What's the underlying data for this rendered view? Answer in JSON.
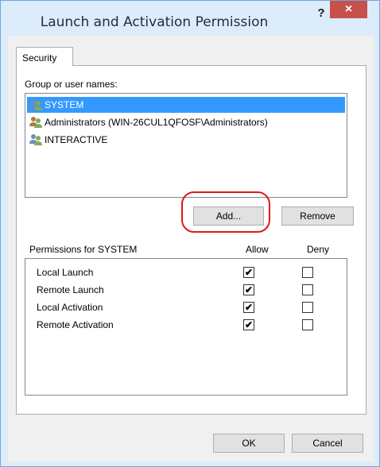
{
  "window": {
    "title": "Launch and Activation Permission",
    "help_label": "?",
    "close_label": "×"
  },
  "tab": {
    "label": "Security"
  },
  "users": {
    "label": "Group or user names:",
    "items": [
      {
        "name": "SYSTEM",
        "selected": true
      },
      {
        "name": "Administrators (WIN-26CUL1QFOSF\\Administrators)",
        "selected": false
      },
      {
        "name": "INTERACTIVE",
        "selected": false
      }
    ]
  },
  "buttons": {
    "add": "Add...",
    "remove": "Remove",
    "ok": "OK",
    "cancel": "Cancel"
  },
  "permissions": {
    "label": "Permissions for SYSTEM",
    "allow_header": "Allow",
    "deny_header": "Deny",
    "rows": [
      {
        "name": "Local Launch",
        "allow": "✔",
        "deny": ""
      },
      {
        "name": "Remote Launch",
        "allow": "✔",
        "deny": ""
      },
      {
        "name": "Local Activation",
        "allow": "✔",
        "deny": ""
      },
      {
        "name": "Remote Activation",
        "allow": "✔",
        "deny": ""
      }
    ]
  },
  "colors": {
    "selection": "#3399ff",
    "close": "#c7504a",
    "highlight": "#e0161c"
  }
}
